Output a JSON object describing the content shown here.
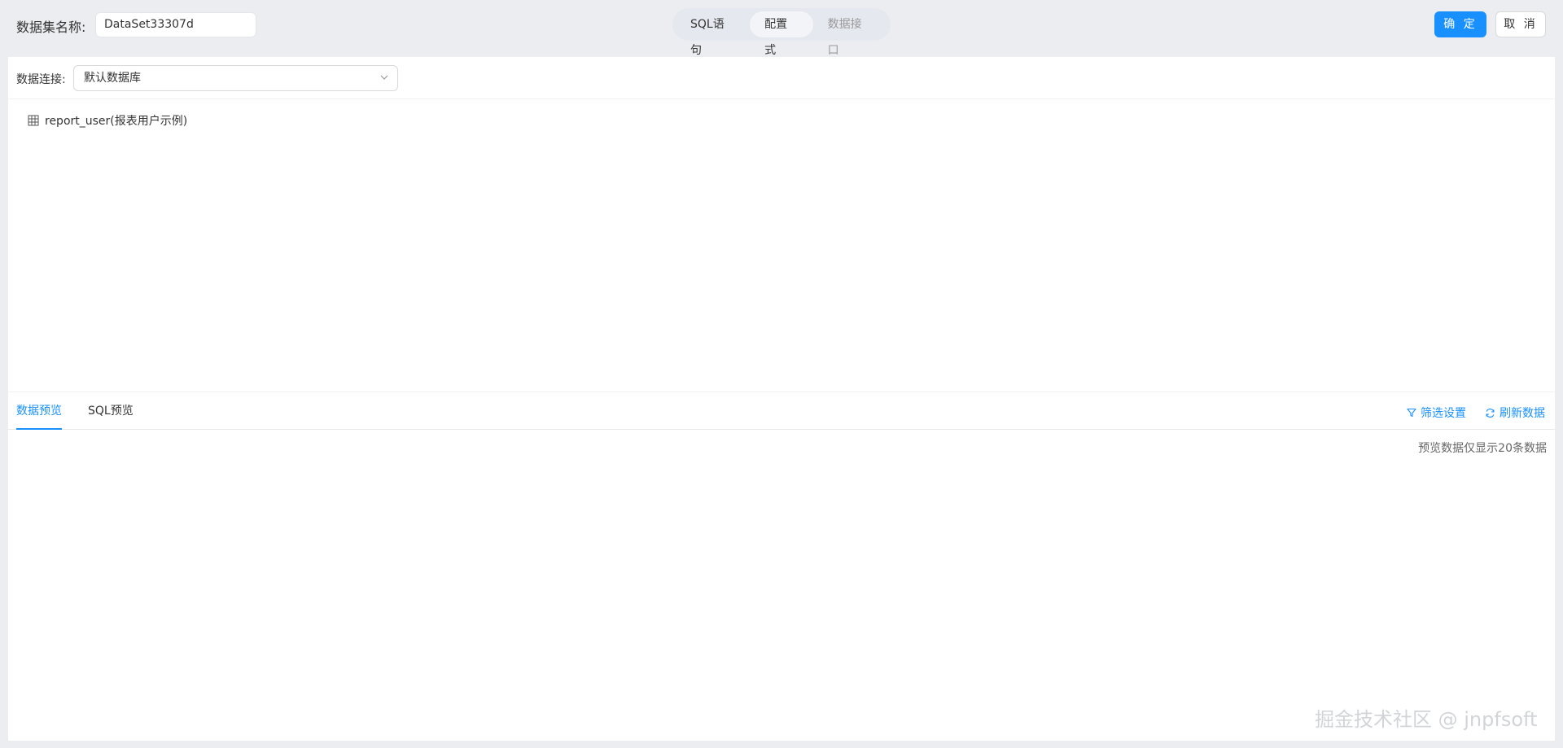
{
  "header": {
    "name_label": "数据集名称:",
    "name_value": "DataSet33307d",
    "modes": [
      {
        "label": "SQL语句"
      },
      {
        "label": "配置式"
      },
      {
        "label": "数据接口"
      }
    ],
    "confirm_label": "确 定",
    "cancel_label": "取 消"
  },
  "connection": {
    "label": "数据连接:",
    "selected": "默认数据库"
  },
  "tree": {
    "items": [
      {
        "label": "report_user(报表用户示例)",
        "icon": "table-icon"
      }
    ]
  },
  "preview": {
    "tabs": [
      {
        "label": "数据预览"
      },
      {
        "label": "SQL预览"
      }
    ],
    "filter_label": "筛选设置",
    "refresh_label": "刷新数据",
    "note": "预览数据仅显示20条数据"
  },
  "watermark": "掘金技术社区 @ jnpfsoft",
  "colors": {
    "primary": "#1890ff",
    "background": "#ebedf1"
  }
}
